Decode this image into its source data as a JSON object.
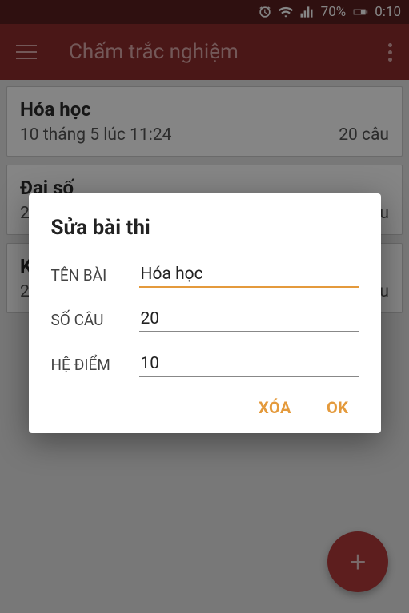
{
  "statusbar": {
    "battery_pct": "70%",
    "time": "0:10"
  },
  "toolbar": {
    "title": "Chấm trắc nghiệm"
  },
  "cards": [
    {
      "title": "Hóa học",
      "date": "10 tháng 5 lúc 11:24",
      "count": "20 câu"
    },
    {
      "title": "Đại số",
      "date": "2",
      "count": "u"
    },
    {
      "title": "K",
      "date": "2",
      "count": "u"
    }
  ],
  "dialog": {
    "title": "Sửa bài thi",
    "labels": {
      "name": "TÊN BÀI",
      "count": "SỐ CÂU",
      "scale": "HỆ ĐIỂM"
    },
    "values": {
      "name": "Hóa học",
      "count": "20",
      "scale": "10"
    },
    "actions": {
      "delete": "XÓA",
      "ok": "OK"
    }
  },
  "fab": {
    "glyph": "+"
  }
}
